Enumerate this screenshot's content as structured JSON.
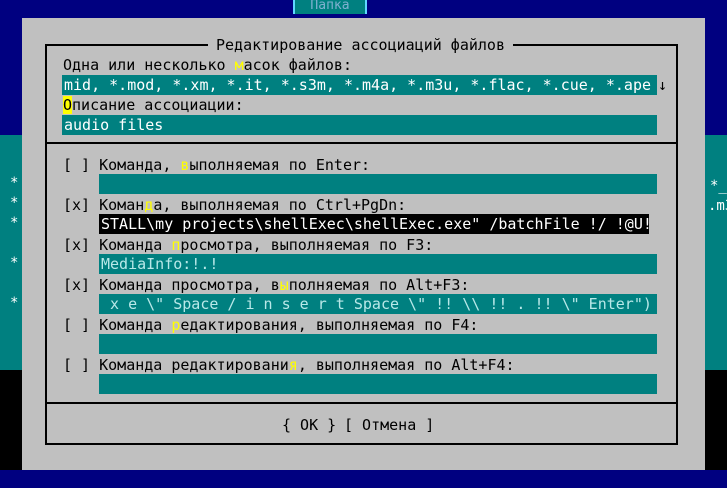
{
  "background": {
    "tab_label": "Папка",
    "left_marks": [
      "*",
      "*",
      "*",
      "*",
      "*"
    ],
    "right_marks": [
      "*_",
      ".m3"
    ]
  },
  "dialog": {
    "title": "Редактирование ассоциаций файлов",
    "masks": {
      "label_pre": "Одна или несколько ",
      "label_hot": "м",
      "label_post": "асок файлов:",
      "value": "mid, *.mod, *.xm, *.it, *.s3m, *.m4a, *.m3u, *.flac, *.cue, *.ape",
      "scroll_arrow": "↓"
    },
    "description": {
      "label_hot": "О",
      "label_post": "писание ассоциации:",
      "value": "audio files"
    },
    "commands": [
      {
        "check": "[ ]",
        "label_pre": "Команда, ",
        "label_hot": "в",
        "label_post": "ыполняемая по Enter:",
        "value": ""
      },
      {
        "check": "[x]",
        "label_pre": "Коман",
        "label_hot": "д",
        "label_post": "а, выполняемая по Ctrl+PgDn:",
        "value": "STALL\\my projects\\shellExec\\shellExec.exe\" /batchFile !/ !@U!"
      },
      {
        "check": "[x]",
        "label_pre": "Команда ",
        "label_hot": "п",
        "label_post": "росмотра, выполняемая по F3:",
        "value": "MediaInfo:!.!"
      },
      {
        "check": "[x]",
        "label_pre": "Команда просмотра, в",
        "label_hot": "ы",
        "label_post": "полняемая по Alt+F3:",
        "value": " x e \\\" Space / i n s e r t Space \\\" !! \\\\ !! . !! \\\" Enter\")"
      },
      {
        "check": "[ ]",
        "label_pre": "Команда ",
        "label_hot": "р",
        "label_post": "едактирования, выполняемая по F4:",
        "value": ""
      },
      {
        "check": "[ ]",
        "label_pre": "Команда редактировани",
        "label_hot": "я",
        "label_post": ", выполняемая по Alt+F4:",
        "value": ""
      }
    ],
    "buttons": {
      "ok": "{ OK }",
      "cancel": "[ Отмена ]"
    }
  },
  "colors": {
    "dialog_bg": "#c0c0c0",
    "field_bg": "#008080",
    "hotkey": "#ffff00",
    "panel_bg": "#000080"
  }
}
